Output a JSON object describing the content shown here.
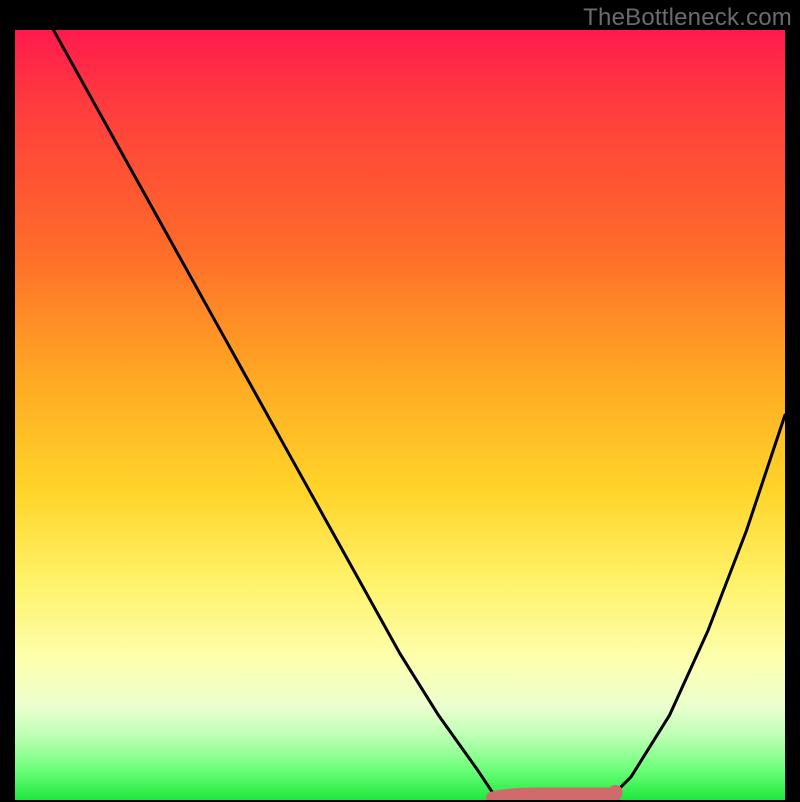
{
  "watermark": "TheBottleneck.com",
  "colors": {
    "curve_stroke": "#000000",
    "marker_stroke": "#d16a6a",
    "marker_fill": "#d16a6a",
    "gradient_top": "#ff1a4d",
    "gradient_bottom": "#1de93e",
    "frame": "#000000"
  },
  "chart_data": {
    "type": "line",
    "title": "",
    "xlabel": "",
    "ylabel": "",
    "xlim": [
      0,
      100
    ],
    "ylim": [
      0,
      100
    ],
    "grid": false,
    "legend": null,
    "series": [
      {
        "name": "bottleneck-curve",
        "x": [
          5,
          10,
          15,
          20,
          25,
          30,
          35,
          40,
          45,
          50,
          55,
          60,
          62,
          65,
          70,
          75,
          78,
          80,
          85,
          90,
          95,
          100
        ],
        "values": [
          100,
          91,
          82,
          73,
          64,
          55,
          46,
          37,
          28,
          19,
          11,
          4,
          1,
          0,
          0,
          0,
          1,
          3,
          11,
          22,
          35,
          50
        ]
      }
    ],
    "optimal_range": {
      "x_start": 62,
      "x_end": 78,
      "value": 0
    },
    "optimal_marker_point": {
      "x": 78,
      "value": 0
    }
  }
}
